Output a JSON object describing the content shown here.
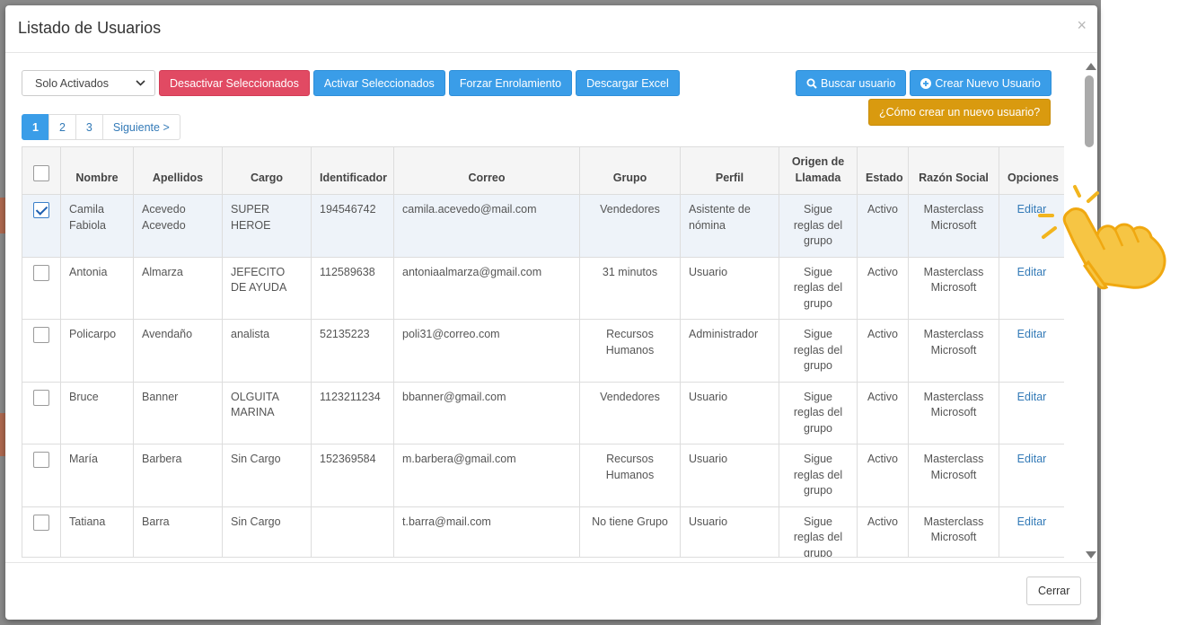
{
  "modal": {
    "title": "Listado de Usuarios",
    "close_symbol": "×"
  },
  "toolbar": {
    "filter_value": "Solo Activados",
    "deactivate_label": "Desactivar Seleccionados",
    "activate_label": "Activar Seleccionados",
    "force_enroll_label": "Forzar Enrolamiento",
    "download_excel_label": "Descargar Excel",
    "search_user_label": "Buscar usuario",
    "create_user_label": "Crear Nuevo Usuario",
    "help_label": "¿Cómo crear un nuevo usuario?"
  },
  "pagination": {
    "pages": [
      "1",
      "2",
      "3"
    ],
    "active_page": "1",
    "next_label": "Siguiente >"
  },
  "table": {
    "columns": [
      "Nombre",
      "Apellidos",
      "Cargo",
      "Identificador",
      "Correo",
      "Grupo",
      "Perfil",
      "Origen de Llamada",
      "Estado",
      "Razón Social",
      "Opciones"
    ],
    "rows": [
      {
        "checked": true,
        "nombre": "Camila Fabiola",
        "apellidos": "Acevedo Acevedo",
        "cargo": "SUPER HEROE",
        "identificador": "194546742",
        "correo": "camila.acevedo@mail.com",
        "grupo": "Vendedores",
        "perfil": "Asistente de nómina",
        "origen": "Sigue reglas del grupo",
        "estado": "Activo",
        "razon": "Masterclass Microsoft",
        "opcion": "Editar"
      },
      {
        "checked": false,
        "nombre": "Antonia",
        "apellidos": "Almarza",
        "cargo": "JEFECITO DE AYUDA",
        "identificador": "112589638",
        "correo": "antoniaalmarza@gmail.com",
        "grupo": "31 minutos",
        "perfil": "Usuario",
        "origen": "Sigue reglas del grupo",
        "estado": "Activo",
        "razon": "Masterclass Microsoft",
        "opcion": "Editar"
      },
      {
        "checked": false,
        "nombre": "Policarpo",
        "apellidos": "Avendaño",
        "cargo": "analista",
        "identificador": "52135223",
        "correo": "poli31@correo.com",
        "grupo": "Recursos Humanos",
        "perfil": "Administrador",
        "origen": "Sigue reglas del grupo",
        "estado": "Activo",
        "razon": "Masterclass Microsoft",
        "opcion": "Editar"
      },
      {
        "checked": false,
        "nombre": "Bruce",
        "apellidos": "Banner",
        "cargo": "OLGUITA MARINA",
        "identificador": "1123211234",
        "correo": "bbanner@gmail.com",
        "grupo": "Vendedores",
        "perfil": "Usuario",
        "origen": "Sigue reglas del grupo",
        "estado": "Activo",
        "razon": "Masterclass Microsoft",
        "opcion": "Editar"
      },
      {
        "checked": false,
        "nombre": "María",
        "apellidos": "Barbera",
        "cargo": "Sin Cargo",
        "identificador": "152369584",
        "correo": "m.barbera@gmail.com",
        "grupo": "Recursos Humanos",
        "perfil": "Usuario",
        "origen": "Sigue reglas del grupo",
        "estado": "Activo",
        "razon": "Masterclass Microsoft",
        "opcion": "Editar"
      },
      {
        "checked": false,
        "nombre": "Tatiana",
        "apellidos": "Barra",
        "cargo": "Sin Cargo",
        "identificador": "",
        "correo": "t.barra@mail.com",
        "grupo": "No tiene Grupo",
        "perfil": "Usuario",
        "origen": "Sigue reglas del grupo",
        "estado": "Activo",
        "razon": "Masterclass Microsoft",
        "opcion": "Editar"
      }
    ]
  },
  "footer": {
    "close_label": "Cerrar"
  },
  "colors": {
    "danger": "#e14a63",
    "info": "#3a9de8",
    "warning": "#d99a0f",
    "link": "#337ab7",
    "hand": "#f6c544"
  },
  "icons": [
    "chevron-down-icon",
    "search-icon",
    "plus-circle-icon",
    "close-icon",
    "pointing-hand-icon"
  ]
}
